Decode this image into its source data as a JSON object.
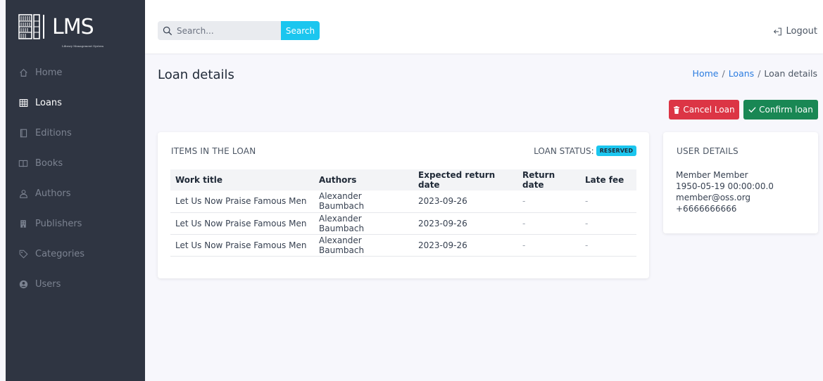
{
  "logo": {
    "text": "LMS",
    "subtitle": "Library Management System"
  },
  "sidebar": {
    "items": [
      {
        "label": "Home",
        "icon": "home-icon",
        "active": false
      },
      {
        "label": "Loans",
        "icon": "table-icon",
        "active": true
      },
      {
        "label": "Editions",
        "icon": "copy-icon",
        "active": false
      },
      {
        "label": "Books",
        "icon": "book-icon",
        "active": false
      },
      {
        "label": "Authors",
        "icon": "user-icon",
        "active": false
      },
      {
        "label": "Publishers",
        "icon": "building-icon",
        "active": false
      },
      {
        "label": "Categories",
        "icon": "tag-icon",
        "active": false
      },
      {
        "label": "Users",
        "icon": "user-circle-icon",
        "active": false
      }
    ]
  },
  "search": {
    "placeholder": "Search...",
    "button": "Search"
  },
  "header": {
    "logout": "Logout"
  },
  "page": {
    "title": "Loan details"
  },
  "breadcrumb": {
    "home": "Home",
    "sep": "/",
    "loans": "Loans",
    "current": "Loan details"
  },
  "actions": {
    "cancel": "Cancel Loan",
    "confirm": "Confirm loan"
  },
  "items_card": {
    "heading": "ITEMS IN THE LOAN",
    "status_label": "LOAN STATUS:",
    "status_value": "RESERVED",
    "columns": [
      "Work title",
      "Authors",
      "Expected return date",
      "Return date",
      "Late fee"
    ],
    "rows": [
      [
        "Let Us Now Praise Famous Men",
        "Alexander Baumbach",
        "2023-09-26",
        "-",
        "-"
      ],
      [
        "Let Us Now Praise Famous Men",
        "Alexander Baumbach",
        "2023-09-26",
        "-",
        "-"
      ],
      [
        "Let Us Now Praise Famous Men",
        "Alexander Baumbach",
        "2023-09-26",
        "-",
        "-"
      ]
    ]
  },
  "user_card": {
    "heading": "USER DETAILS",
    "name": "Member Member",
    "birth": "1950-05-19 00:00:00.0",
    "email": "member@oss.org",
    "phone": "+6666666666"
  },
  "colors": {
    "sidebar": "#2f3542",
    "accent": "#1bc6ef",
    "danger": "#dc3545",
    "success": "#198754",
    "link": "#2b7ce0"
  }
}
